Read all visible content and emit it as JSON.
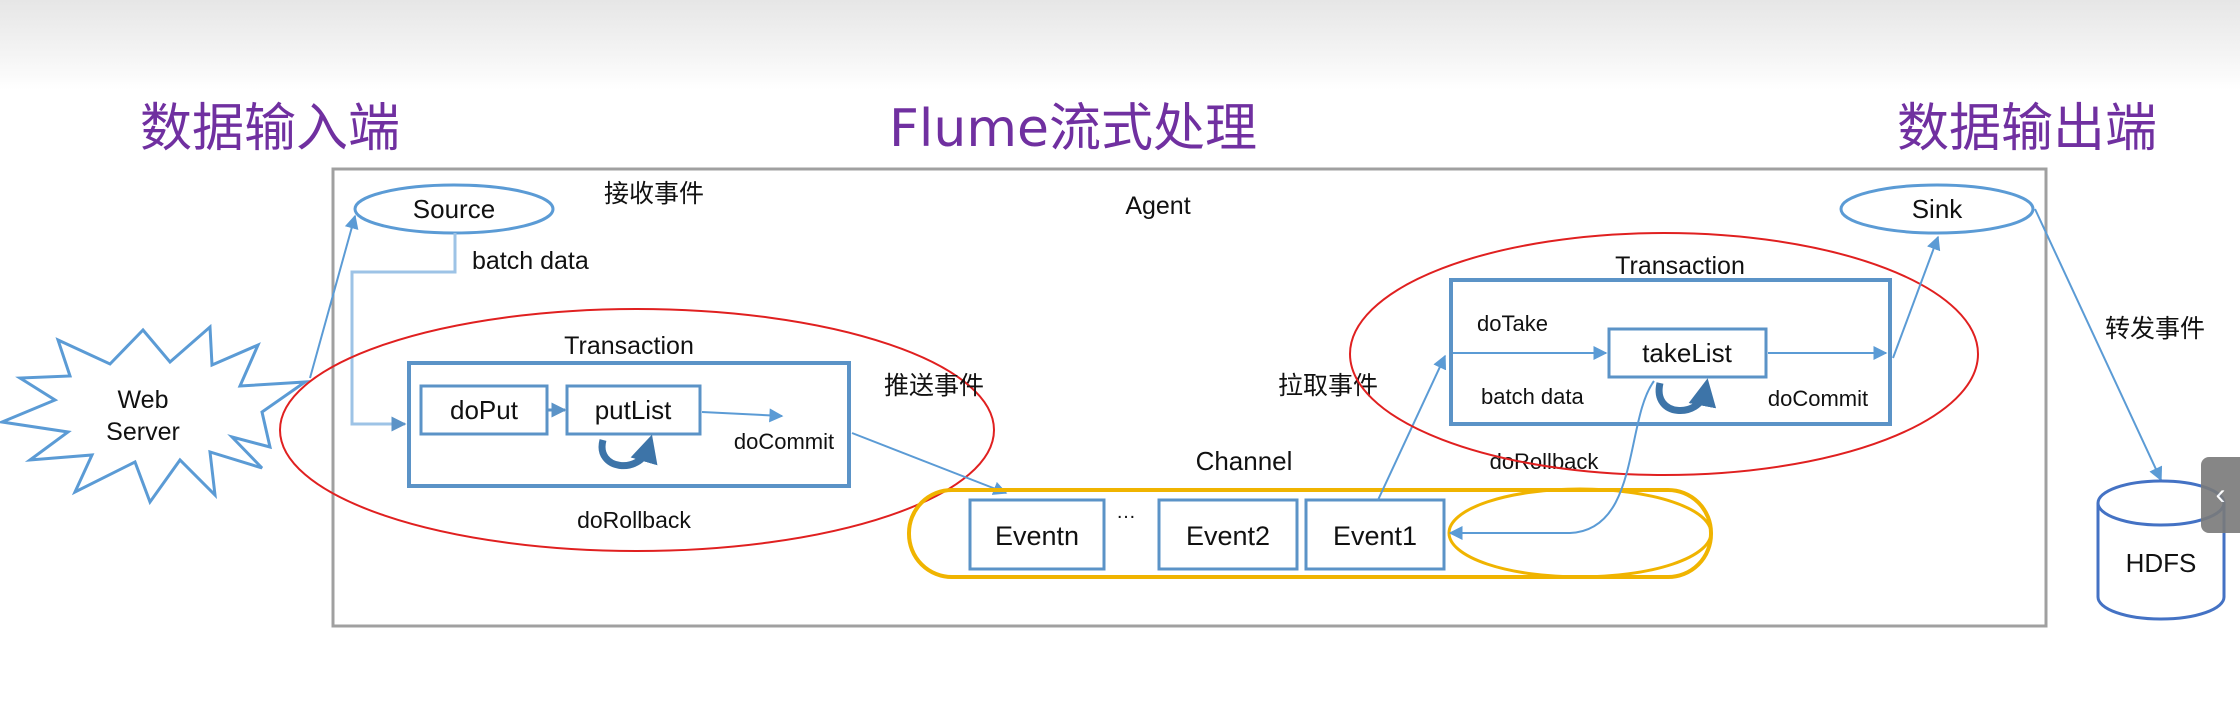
{
  "titles": {
    "input": "数据输入端",
    "processing": "Flume流式处理",
    "output": "数据输出端"
  },
  "agent": {
    "label": "Agent"
  },
  "nodes": {
    "web_server": [
      "Web",
      "Server"
    ],
    "source": "Source",
    "sink": "Sink",
    "hdfs": "HDFS"
  },
  "annotations": {
    "receive_event": "接收事件",
    "push_event": "推送事件",
    "pull_event": "拉取事件",
    "forward_event": "转发事件"
  },
  "put_transaction": {
    "title": "Transaction",
    "do_put": "doPut",
    "put_list": "putList",
    "do_commit": "doCommit",
    "do_rollback": "doRollback",
    "batch_data": "batch data"
  },
  "take_transaction": {
    "title": "Transaction",
    "do_take": "doTake",
    "take_list": "takeList",
    "batch_data": "batch data",
    "do_commit": "doCommit",
    "do_rollback": "doRollback"
  },
  "channel": {
    "label": "Channel",
    "events": [
      "Eventn",
      "Event2",
      "Event1"
    ],
    "ellipsis": "…"
  },
  "colors": {
    "title_purple": "#7030a0",
    "node_blue": "#5b9bd5",
    "box_blue": "#5b93c7",
    "highlight_red": "#e02020",
    "channel_yellow": "#f0b400",
    "agent_gray": "#a0a0a0"
  },
  "side_tab": {
    "icon": "‹"
  }
}
